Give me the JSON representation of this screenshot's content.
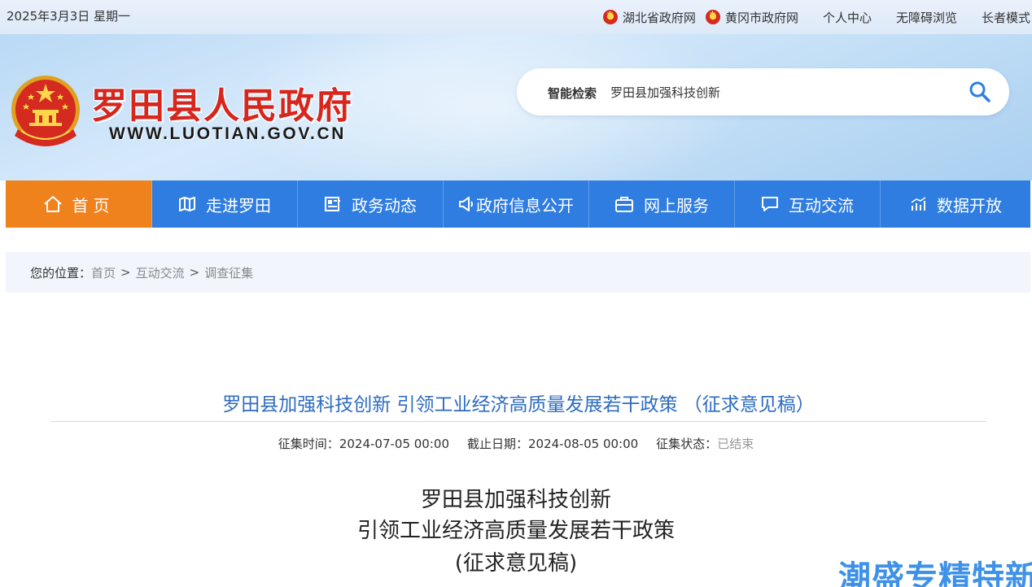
{
  "topbar": {
    "date": "2025年3月3日 星期一",
    "links": [
      {
        "label": "湖北省政府网",
        "emblem": true
      },
      {
        "label": "黄冈市政府网",
        "emblem": true
      },
      {
        "label": "个人中心"
      },
      {
        "label": "无障碍浏览"
      },
      {
        "label": "长者模式"
      }
    ]
  },
  "header": {
    "title": "罗田县人民政府",
    "url": "WWW.LUOTIAN.GOV.CN",
    "search": {
      "label": "智能检索",
      "value": "罗田县加强科技创新",
      "icon": "search-icon"
    }
  },
  "nav": {
    "items": [
      {
        "label": "首页",
        "icon": "home-icon",
        "active": true
      },
      {
        "label": "走进罗田",
        "icon": "map-icon"
      },
      {
        "label": "政务动态",
        "icon": "news-icon"
      },
      {
        "label": "政府信息公开",
        "icon": "megaphone-icon"
      },
      {
        "label": "网上服务",
        "icon": "briefcase-icon"
      },
      {
        "label": "互动交流",
        "icon": "chat-icon"
      },
      {
        "label": "数据开放",
        "icon": "chart-icon"
      }
    ]
  },
  "breadcrumb": {
    "prefix": "您的位置：",
    "items": [
      "首页",
      "互动交流",
      "调查征集"
    ],
    "separator": ">"
  },
  "article": {
    "title": "罗田县加强科技创新 引领工业经济高质量发展若干政策 （征求意见稿）",
    "meta": {
      "start_label": "征集时间：",
      "start_value": "2024-07-05 00:00",
      "end_label": "截止日期：",
      "end_value": "2024-08-05 00:00",
      "status_label": "征集状态：",
      "status_value": "已结束"
    },
    "doc_title_lines": [
      "罗田县加强科技创新",
      "引领工业经济高质量发展若干政策",
      "(征求意见稿)"
    ]
  },
  "watermark": "潮盛专精特新",
  "colors": {
    "brand_red": "#d7261e",
    "nav_blue": "#2f7de1",
    "nav_active": "#f0821e",
    "title_blue": "#2e6cc1"
  }
}
